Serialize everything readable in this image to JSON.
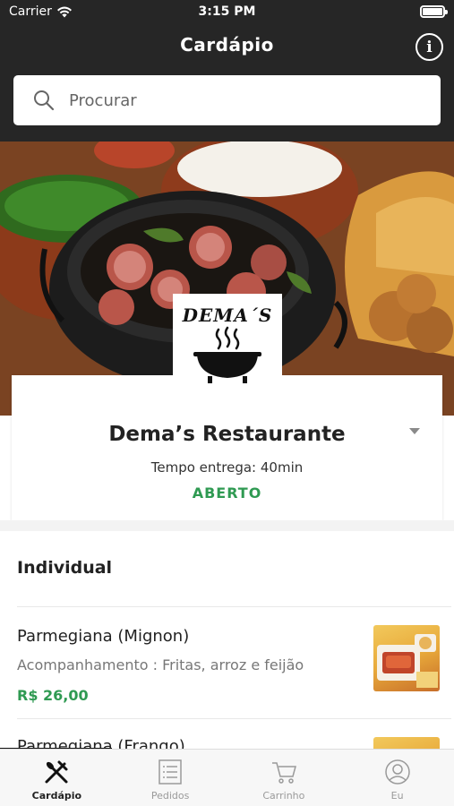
{
  "status_bar": {
    "carrier": "Carrier",
    "time": "3:15 PM"
  },
  "header": {
    "title": "Cardápio",
    "info_glyph": "i"
  },
  "search": {
    "placeholder": "Procurar",
    "value": ""
  },
  "restaurant": {
    "logo_text": "DEMA´S",
    "name": "Dema’s Restaurante",
    "delivery_time": "Tempo entrega: 40min",
    "status": "ABERTO",
    "status_color": "#2f9a52"
  },
  "menu": {
    "section_title": "Individual",
    "items": [
      {
        "name": "Parmegiana (Mignon)",
        "description": "Acompanhamento : Fritas, arroz e feijão",
        "price": "R$ 26,00"
      },
      {
        "name": "Parmegiana (Frango)",
        "description": "",
        "price": ""
      }
    ]
  },
  "tabbar": {
    "tabs": [
      {
        "label": "Cardápio",
        "icon": "fork-knife-icon",
        "active": true
      },
      {
        "label": "Pedidos",
        "icon": "list-icon",
        "active": false
      },
      {
        "label": "Carrinho",
        "icon": "cart-icon",
        "active": false
      },
      {
        "label": "Eu",
        "icon": "user-icon",
        "active": false
      }
    ]
  },
  "colors": {
    "header_bg": "#262626",
    "accent_green": "#2f9a52"
  }
}
